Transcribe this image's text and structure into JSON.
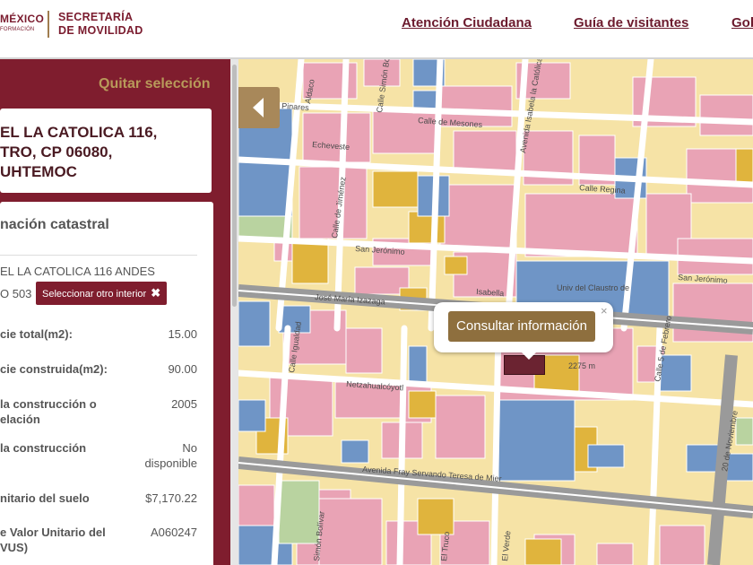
{
  "header": {
    "logo_mexico_line1": "MÉXICO",
    "logo_mexico_line2": "FORMACIÓN",
    "logo_secretaria_line1": "SECRETARÍA",
    "logo_secretaria_line2": "DE MOVILIDAD",
    "nav": [
      "Atención Ciudadana",
      "Guía de visitantes",
      "Gob"
    ]
  },
  "panel": {
    "quitar_label": "Quitar selección",
    "address_lines": [
      "EL LA CATOLICA 116,",
      "TRO, CP 06080,",
      "UHTEMOC"
    ],
    "info_title": "nación catastral",
    "info_address_line1": "EL LA CATOLICA 116 ANDES",
    "info_address_line2": "O 503",
    "select_interior_label": "Seleccionar otro interior",
    "rows": [
      {
        "label": "cie total(m2):",
        "value": "15.00"
      },
      {
        "label": "cie construida(m2):",
        "value": "90.00"
      },
      {
        "label": "la construcción o elación",
        "value": "2005"
      },
      {
        "label": "la construcción",
        "value": "No disponible"
      },
      {
        "label": "nitario del suelo",
        "value": "$7,170.22"
      },
      {
        "label": "e Valor Unitario del VUS)",
        "value": "A060247"
      }
    ]
  },
  "map": {
    "popup_button_label": "Consultar información",
    "popup_close": "×",
    "streets": [
      "Calle de Mesones",
      "Calle Regina",
      "San Jerónimo",
      "San Jerónimo",
      "José María Izazaga",
      "Isabella",
      "Netzahualcóyotl",
      "Avenida Fray Servando Teresa de Mier",
      "Avenida Isabela la Católica",
      "Calle 5 de Febrero",
      "20 de Noviembre",
      "Echeveste",
      "Calle Simón Bolívar",
      "Calle de Jiménez",
      "Calle Igualdad",
      "El Truco",
      "El Verde",
      "Simón Bolívar",
      "Pinares",
      "Aldaco",
      "Univ del Claustro de"
    ],
    "scale_label": "2275 m",
    "colors": {
      "pink": "#e9a3b5",
      "yellow": "#f6e3a6",
      "gold": "#e0b43d",
      "blue": "#6f95c6",
      "green": "#b9d3a0",
      "road": "#ffffff",
      "major_road": "#9a9a9a",
      "selected": "#6b2331"
    }
  }
}
